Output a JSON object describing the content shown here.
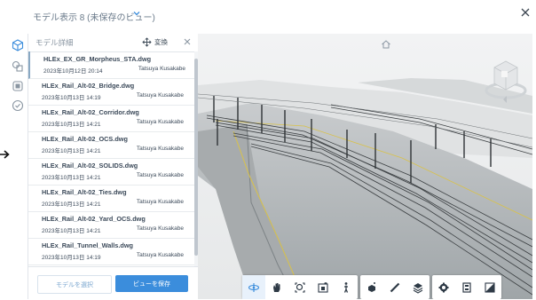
{
  "header": {
    "title": "モデル表示 8 (未保存のビュー)",
    "close_icon": "close-icon"
  },
  "rail": {
    "icons": [
      "cube-icon",
      "models-icon",
      "layers-icon",
      "check-circle-icon"
    ]
  },
  "panel": {
    "title": "モデル詳細",
    "transform_label": "変換",
    "files": [
      {
        "name": "HLEx_EX_GR_Morpheus_STA.dwg",
        "date": "2023年10月12日 20:14",
        "user": "Tatsuya Kusakabe"
      },
      {
        "name": "HLEx_Rail_Alt-02_Bridge.dwg",
        "date": "2023年10月13日 14:19",
        "user": "Tatsuya Kusakabe"
      },
      {
        "name": "HLEx_Rail_Alt-02_Corridor.dwg",
        "date": "2023年10月13日 14:21",
        "user": "Tatsuya Kusakabe"
      },
      {
        "name": "HLEx_Rail_Alt-02_OCS.dwg",
        "date": "2023年10月13日 14:21",
        "user": "Tatsuya Kusakabe"
      },
      {
        "name": "HLEx_Rail_Alt-02_SOLIDS.dwg",
        "date": "2023年10月13日 14:21",
        "user": "Tatsuya Kusakabe"
      },
      {
        "name": "HLEx_Rail_Alt-02_Ties.dwg",
        "date": "2023年10月13日 14:21",
        "user": "Tatsuya Kusakabe"
      },
      {
        "name": "HLEx_Rail_Alt-02_Yard_OCS.dwg",
        "date": "2023年10月13日 14:21",
        "user": "Tatsuya Kusakabe"
      },
      {
        "name": "HLEx_Rail_Tunnel_Walls.dwg",
        "date": "2023年10月13日 14:19",
        "user": "Tatsuya Kusakabe"
      }
    ],
    "select_model_label": "モデルを選択",
    "save_view_label": "ビューを保存"
  },
  "viewport": {
    "home_icon": "home-icon",
    "viewcube": "viewcube-icon",
    "toolbar_groups": [
      [
        "orbit-icon",
        "pan-icon",
        "zoom-window-icon",
        "fit-to-view-icon",
        "walk-icon"
      ],
      [
        "explode-icon",
        "measure-icon",
        "layers-stack-icon"
      ],
      [
        "settings-icon",
        "properties-icon",
        "fullscreen-icon"
      ]
    ]
  },
  "colors": {
    "accent": "#3b8ddc",
    "rail_line": "#e1e5ea",
    "text": "#3c4a5a"
  }
}
